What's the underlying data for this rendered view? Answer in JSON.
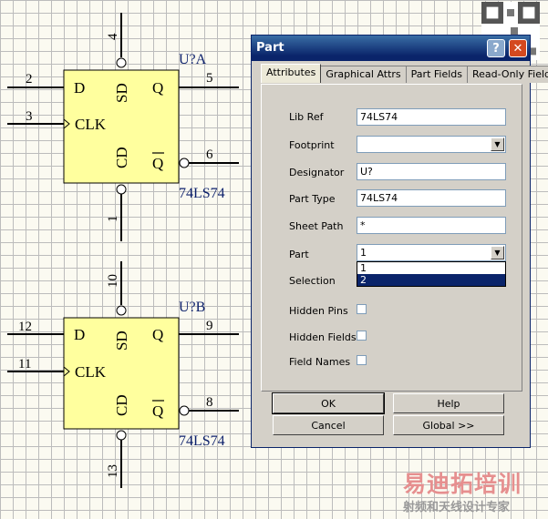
{
  "schematic": {
    "u1": {
      "ref": "U?A",
      "part": "74LS74",
      "pins": {
        "d": "2",
        "clk": "3",
        "q": "5",
        "qbar": "6",
        "sd": "4",
        "cd": "1"
      }
    },
    "u2": {
      "ref": "U?B",
      "part": "74LS74",
      "pins": {
        "d": "12",
        "clk": "11",
        "q": "9",
        "qbar": "8",
        "sd": "10",
        "cd": "13"
      }
    },
    "signals": {
      "d": "D",
      "clk": "CLK",
      "q": "Q",
      "qbar": "Q",
      "sd": "SD",
      "cd": "CD"
    },
    "colors": {
      "body": "#ffff9e",
      "ref": "#0b1f6b",
      "grid": "#bcbcbc"
    }
  },
  "dialog": {
    "title": "Part",
    "tabs": [
      "Attributes",
      "Graphical Attrs",
      "Part Fields",
      "Read-Only Fields"
    ],
    "fields": {
      "lib_ref": {
        "label": "Lib Ref",
        "value": "74LS74"
      },
      "footprint": {
        "label": "Footprint",
        "value": ""
      },
      "designator": {
        "label": "Designator",
        "value": "U?"
      },
      "part_type": {
        "label": "Part Type",
        "value": "74LS74"
      },
      "sheet_path": {
        "label": "Sheet Path",
        "value": "*"
      },
      "part": {
        "label": "Part",
        "value": "1",
        "options": [
          "1",
          "2"
        ],
        "highlighted": "2"
      },
      "selection": {
        "label": "Selection"
      },
      "hidden_pins": {
        "label": "Hidden Pins",
        "checked": false
      },
      "hidden_fields": {
        "label": "Hidden Fields",
        "checked": false
      },
      "field_names": {
        "label": "Field Names",
        "checked": false
      }
    },
    "buttons": {
      "ok": "OK",
      "help": "Help",
      "cancel": "Cancel",
      "global": "Global >>"
    }
  },
  "watermark": {
    "brand": "易迪拓培训",
    "slogan": "射频和天线设计专家"
  }
}
